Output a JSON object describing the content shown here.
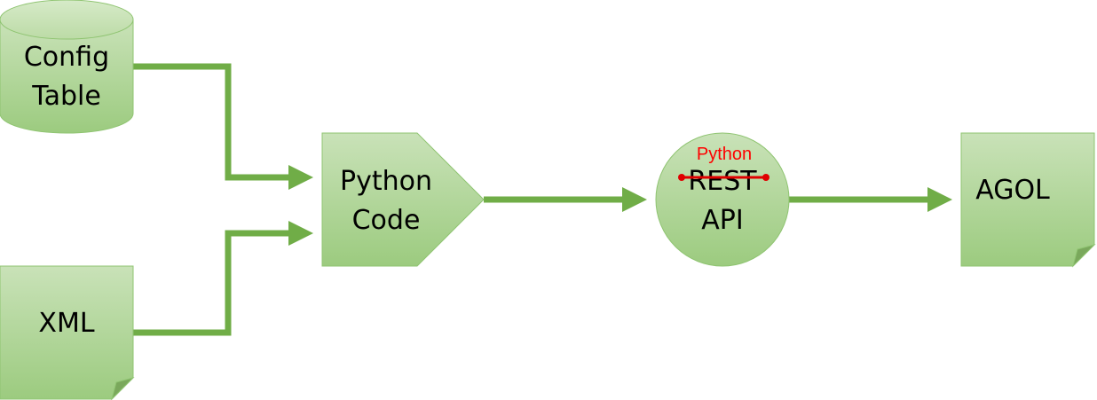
{
  "nodes": {
    "config_table": {
      "line1": "Config",
      "line2": "Table"
    },
    "xml": {
      "label": "XML"
    },
    "python_code": {
      "line1": "Python",
      "line2": "Code"
    },
    "rest_api": {
      "line1": "REST",
      "line2": "API",
      "annotation": "Python"
    },
    "agol": {
      "label": "AGOL"
    }
  },
  "colors": {
    "connector": "#70ad47",
    "shape_fill_top": "#c5e0b4",
    "shape_fill_bottom": "#a9d18e",
    "shape_border": "#70ad47",
    "annotation": "#ff0000",
    "strike_line": "#c00000"
  }
}
